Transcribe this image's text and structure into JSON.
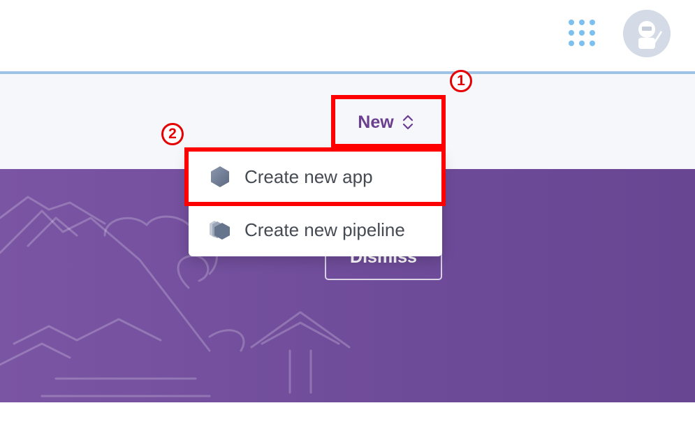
{
  "header": {
    "apps_icon": "apps-grid-icon",
    "avatar_icon": "user-avatar-icon"
  },
  "toolbar": {
    "new_label": "New",
    "new_icon": "chevron-up-down-icon"
  },
  "dropdown": {
    "items": [
      {
        "label": "Create new app",
        "icon": "hexagon-icon"
      },
      {
        "label": "Create new pipeline",
        "icon": "stacked-hexagons-icon"
      }
    ]
  },
  "banner": {
    "dismiss_label": "Dismiss"
  },
  "annotations": [
    {
      "number": "1"
    },
    {
      "number": "2"
    }
  ],
  "colors": {
    "brand_purple": "#6b3f8f",
    "banner_purple": "#7a55a3",
    "callout_red": "#ff0000",
    "accent_line": "#9fc3e6"
  }
}
